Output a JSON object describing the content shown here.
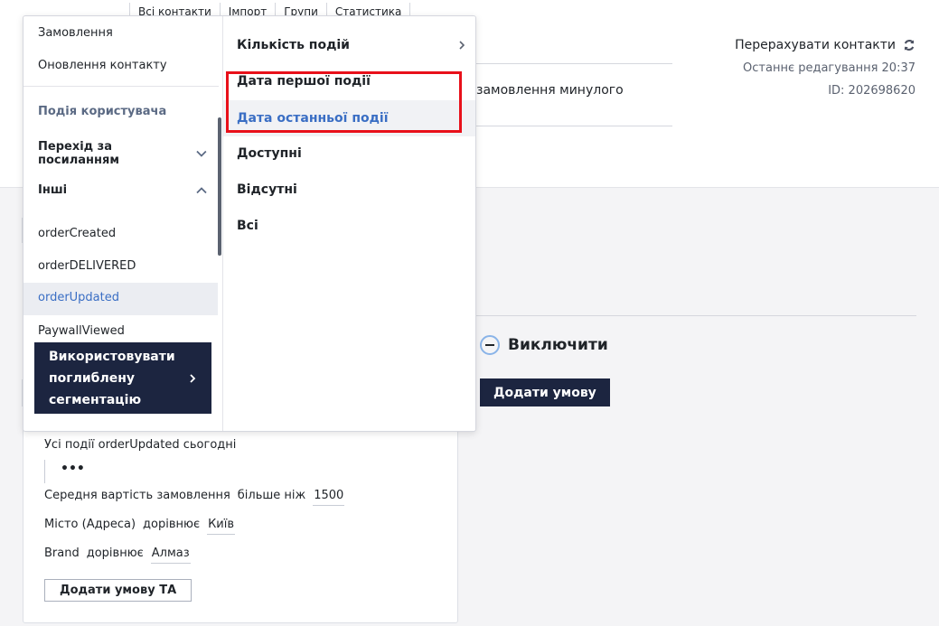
{
  "tabs": [
    "Всі контакти",
    "Імпорт",
    "Групи",
    "Статистика"
  ],
  "header": {
    "recalc_label": "Перерахувати контакти",
    "last_edit": "Останнє редагування 20:37",
    "id": "ID: 202698620",
    "segment_description": "замовлення минулого"
  },
  "exclude": {
    "label": "Виключити",
    "add_condition_label": "Додати умову"
  },
  "card": {
    "rows": [
      {
        "text": "Усі події orderUpdated сьогодні"
      }
    ],
    "dots": "•••",
    "cond1": {
      "field": "Середня вартість замовлення",
      "op": "більше ніж",
      "value": "1500"
    },
    "cond2": {
      "field": "Місто (Адреса)",
      "op": "дорівнює",
      "value": "Київ"
    },
    "cond3": {
      "field": "Brand",
      "op": "дорівнює",
      "value": "Алмаз"
    },
    "add_and_label": "Додати умову ТА"
  },
  "dropdown": {
    "left": {
      "items_top": [
        "Замовлення",
        "Оновлення контакту"
      ],
      "group_label": "Подія користувача",
      "expander1": "Перехід за посиланням",
      "expander2": "Інші",
      "events": [
        "orderCreated",
        "orderDELIVERED",
        "orderUpdated",
        "PaywallViewed"
      ],
      "selected_event": "orderUpdated",
      "deep_segmentation": "Використовувати поглиблену сегментацію"
    },
    "right": {
      "options": [
        "Кількість подій",
        "Дата першої події",
        "Дата останньої події",
        "Доступні",
        "Відсутні",
        "Всі"
      ],
      "hovered": "Дата останньої події"
    }
  },
  "colors": {
    "accent": "#3a6ec4",
    "dark": "#1c2540",
    "highlight_box": "#e8101a"
  }
}
